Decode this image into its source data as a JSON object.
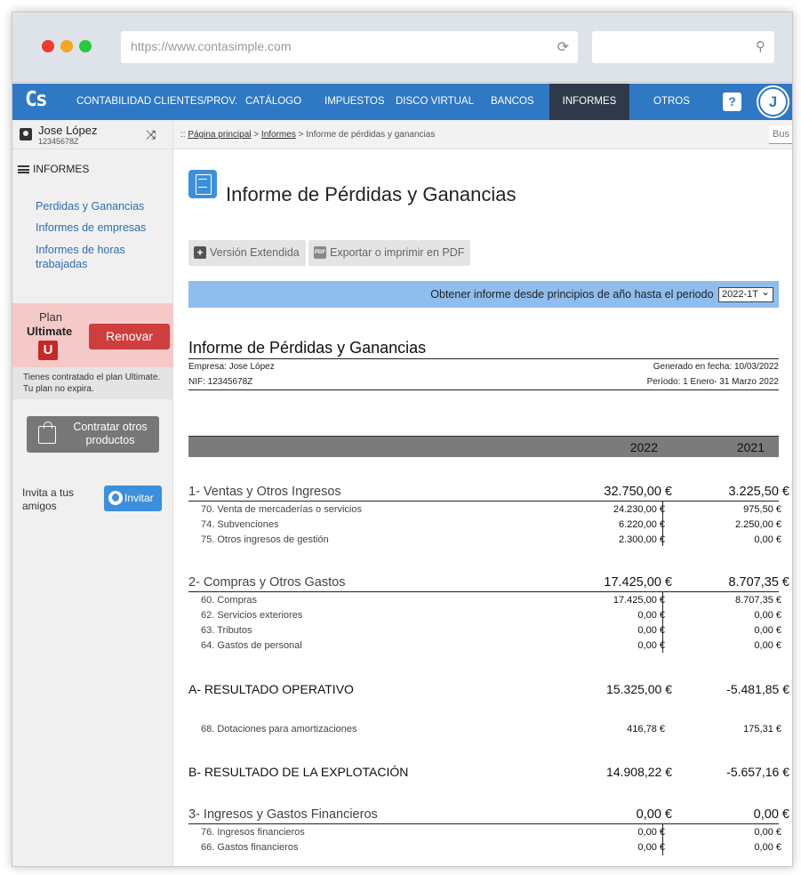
{
  "browser": {
    "url": "https://www.contasimple.com",
    "reload_icon": "reload-icon",
    "search_icon": "search-icon"
  },
  "nav": {
    "logo": "Cs",
    "items": [
      "CONTABILIDAD",
      "CLIENTES/PROV.",
      "CATÁLOGO",
      "IMPUESTOS",
      "DISCO VIRTUAL",
      "BANCOS",
      "INFORMES",
      "OTROS"
    ],
    "active": "INFORMES",
    "help": "?",
    "avatar": "J"
  },
  "user": {
    "name": "Jose López",
    "nif": "12345678Z"
  },
  "sidebar": {
    "section": "INFORMES",
    "links": [
      "Perdidas y Ganancias",
      "Informes de empresas",
      "Informes de horas trabajadas"
    ],
    "plan": {
      "title": "Plan",
      "name": "Ultimate",
      "badge": "U",
      "renew": "Renovar"
    },
    "plan_note": "Tienes contratado el plan Ultimate. Tu plan no expira.",
    "buy": "Contratar otros productos",
    "invite_text": "Invita a tus amigos",
    "invite_btn": "Invitar"
  },
  "breadcrumb": {
    "prefix": ":: ",
    "home": "Página principal",
    "sep1": " > ",
    "reports": "Informes",
    "sep2": " > ",
    "current": "Informe de pérdidas y ganancias",
    "search": "Bus"
  },
  "page": {
    "title": "Informe de Pérdidas y Ganancias",
    "btn_extended": "Versión Extendida",
    "btn_export": "Exportar o imprimir en PDF",
    "filter_label": "Obtener informe desde principios de año hasta el periodo",
    "filter_value": "2022-1T"
  },
  "report": {
    "title": "Informe de Pérdidas y Ganancias",
    "company": "Empresa: Jose López",
    "nif": "NIF: 12345678Z",
    "generated": "Generado en fecha: 10/03/2022",
    "period": "Período: 1 Enero- 31 Marzo 2022",
    "year1": "2022",
    "year2": "2021",
    "s1": {
      "title": "1- Ventas y Otros Ingresos",
      "v1": "32.750,00 €",
      "v2": "3.225,50 €",
      "rows": [
        {
          "label": "70. Venta de mercaderías o servicios",
          "v1": "24.230,00 €",
          "v2": "975,50 €"
        },
        {
          "label": "74. Subvenciones",
          "v1": "6.220,00 €",
          "v2": "2.250,00 €"
        },
        {
          "label": "75. Otros ingresos de gestión",
          "v1": "2.300,00 €",
          "v2": "0,00 €"
        }
      ]
    },
    "s2": {
      "title": "2- Compras y Otros Gastos",
      "v1": "17.425,00 €",
      "v2": "8.707,35 €",
      "rows": [
        {
          "label": "60. Compras",
          "v1": "17.425,00 €",
          "v2": "8.707,35 €"
        },
        {
          "label": "62. Servicios exteriores",
          "v1": "0,00 €",
          "v2": "0,00 €"
        },
        {
          "label": "63. Tributos",
          "v1": "0,00 €",
          "v2": "0,00 €"
        },
        {
          "label": "64. Gastos de personal",
          "v1": "0,00 €",
          "v2": "0,00 €"
        }
      ]
    },
    "ra": {
      "title": "A- RESULTADO OPERATIVO",
      "v1": "15.325,00 €",
      "v2": "-5.481,85 €"
    },
    "amort": {
      "label": "68. Dotaciones para amortizaciones",
      "v1": "416,78 €",
      "v2": "175,31 €"
    },
    "rb": {
      "title": "B- RESULTADO DE LA EXPLOTACIÓN",
      "v1": "14.908,22 €",
      "v2": "-5.657,16 €"
    },
    "s3": {
      "title": "3- Ingresos y Gastos Financieros",
      "v1": "0,00 €",
      "v2": "0,00 €",
      "rows": [
        {
          "label": "76. Ingresos financieros",
          "v1": "0,00 €",
          "v2": "0,00 €"
        },
        {
          "label": "66. Gastos financieros",
          "v1": "0,00 €",
          "v2": "0,00 €"
        }
      ]
    }
  }
}
